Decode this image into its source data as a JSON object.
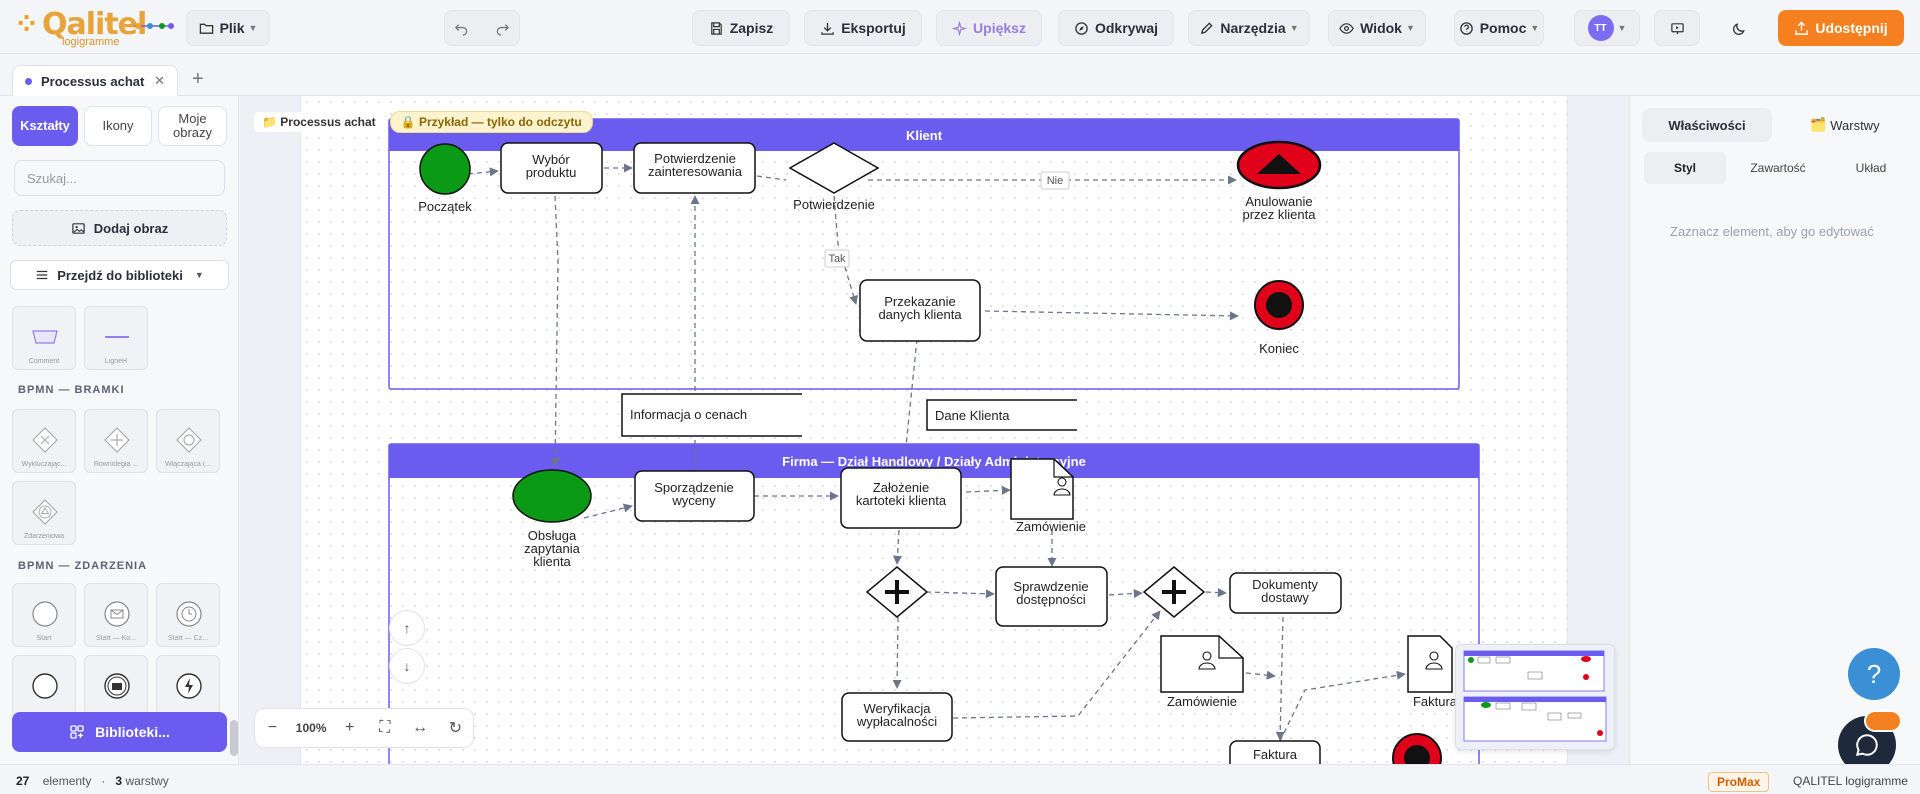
{
  "app": {
    "logo_text": "Qalitel",
    "logo_sub": "logigramme"
  },
  "toolbar": {
    "file": "Plik",
    "save": "Zapisz",
    "export": "Eksportuj",
    "beautify": "Upiększ",
    "discover": "Odkrywaj",
    "tools": "Narzędzia",
    "view": "Widok",
    "help": "Pomoc",
    "avatar_initials": "TT",
    "share": "Udostępnij"
  },
  "tabs": {
    "items": [
      {
        "label": "Processus achat"
      }
    ]
  },
  "left_panel": {
    "segments": [
      "Kształty",
      "Ikony",
      "Moje obrazy"
    ],
    "search_placeholder": "Szukaj...",
    "add_image": "Dodaj obraz",
    "go_library": "Przejdź do biblioteki",
    "top_shapes": [
      "Comment",
      "LigneH"
    ],
    "section_gateways": "BPMN — BRAMKI",
    "gateways": [
      "Wykluczając...",
      "Równoległa ...",
      "Włączająca (...",
      "Zdarzeniowa"
    ],
    "section_events": "BPMN — ZDARZENIA",
    "events": [
      "Start",
      "Start — Ko...",
      "Start — Cz...",
      "",
      "",
      ""
    ],
    "libraries_button": "Biblioteki..."
  },
  "canvas": {
    "breadcrumb_title": "Processus achat",
    "readonly_badge": "Przykład — tylko do odczytu",
    "zoom": "100%"
  },
  "diagram": {
    "lane_top": "Klient",
    "lane_bottom": "Firma — Dział Handlowy / Działy Administracyjne",
    "start_event": "Początek",
    "task_choose": [
      "Wybór",
      "produktu"
    ],
    "task_confirm_interest": [
      "Potwierdzenie",
      "zainteresowania"
    ],
    "gateway_confirm": "Potwierdzenie",
    "cancel_event": [
      "Anulowanie",
      "przez klienta"
    ],
    "label_no": "Nie",
    "label_yes": "Tak",
    "task_send_data": [
      "Przekazanie",
      "danych klienta"
    ],
    "end_event": "Koniec",
    "data_price_info": "Informacja o cenach",
    "data_client": "Dane Klienta",
    "start_inquiry": [
      "Obsługa",
      "zapytania",
      "klienta"
    ],
    "task_quote": [
      "Sporządzenie",
      "wyceny"
    ],
    "task_file": [
      "Założenie",
      "kartoteki klienta"
    ],
    "doc_order1": "Zamówienie",
    "task_availability": [
      "Sprawdzenie",
      "dostępności"
    ],
    "task_delivery_docs": [
      "Dokumenty",
      "dostawy"
    ],
    "task_verify": [
      "Weryfikacja",
      "wypłacalności"
    ],
    "doc_order2": "Zamówienie",
    "doc_invoice": "Faktura",
    "task_invoice": "Faktura"
  },
  "right_panel": {
    "tabs": [
      "Właściwości",
      "Warstwy"
    ],
    "subtabs": [
      "Styl",
      "Zawartość",
      "Układ"
    ],
    "hint": "Zaznacz element, aby go edytować"
  },
  "status": {
    "elements_count": "27",
    "elements_label": "elementy",
    "layers_count": "3",
    "layers_label": "warstwy",
    "plan": "ProMax",
    "brand": "QALITEL logigramme"
  },
  "colors": {
    "accent": "#6b5cf0",
    "share": "#f5801f",
    "start_green": "#0a9a16",
    "end_red": "#e0001a"
  }
}
